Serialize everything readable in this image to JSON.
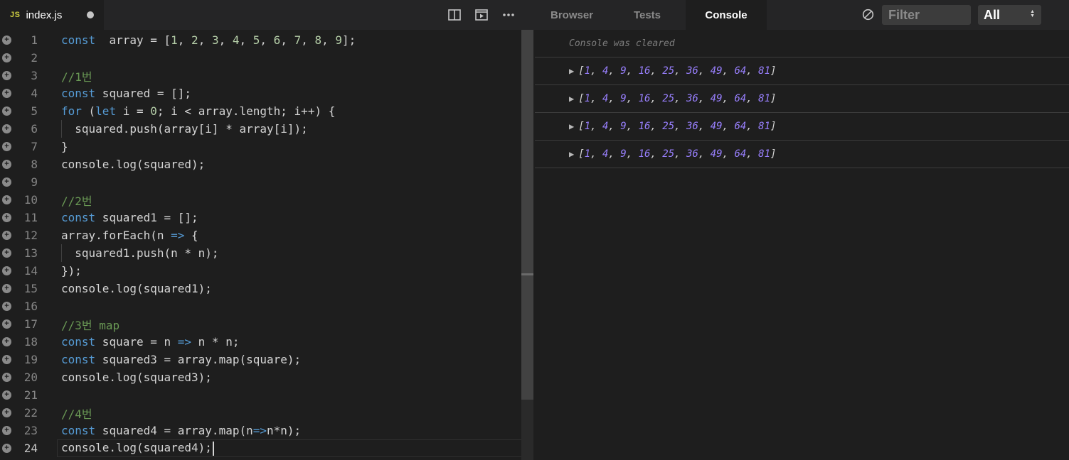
{
  "tab": {
    "icon": "JS",
    "name": "index.js"
  },
  "panel_tabs": [
    "Browser",
    "Tests",
    "Console"
  ],
  "filter": {
    "placeholder": "Filter",
    "level": "All"
  },
  "editor": {
    "lines": [
      {
        "num": "1",
        "tokens": [
          [
            "kw",
            "const"
          ],
          [
            "",
            "  array = ["
          ],
          [
            "nm",
            "1"
          ],
          [
            "",
            ", "
          ],
          [
            "nm",
            "2"
          ],
          [
            "",
            ", "
          ],
          [
            "nm",
            "3"
          ],
          [
            "",
            ", "
          ],
          [
            "nm",
            "4"
          ],
          [
            "",
            ", "
          ],
          [
            "nm",
            "5"
          ],
          [
            "",
            ", "
          ],
          [
            "nm",
            "6"
          ],
          [
            "",
            ", "
          ],
          [
            "nm",
            "7"
          ],
          [
            "",
            ", "
          ],
          [
            "nm",
            "8"
          ],
          [
            "",
            ", "
          ],
          [
            "nm",
            "9"
          ],
          [
            "",
            "];"
          ]
        ]
      },
      {
        "num": "2",
        "tokens": []
      },
      {
        "num": "3",
        "tokens": [
          [
            "cm",
            "//1번"
          ]
        ]
      },
      {
        "num": "4",
        "tokens": [
          [
            "kw",
            "const"
          ],
          [
            "",
            " squared = [];"
          ]
        ]
      },
      {
        "num": "5",
        "tokens": [
          [
            "kw",
            "for"
          ],
          [
            "",
            " ("
          ],
          [
            "kw",
            "let"
          ],
          [
            "",
            " i = "
          ],
          [
            "nm",
            "0"
          ],
          [
            "",
            "; i < array.length; i++) {"
          ]
        ]
      },
      {
        "num": "6",
        "tokens": [
          [
            "",
            "  squared.push(array[i] * array[i]);"
          ]
        ],
        "guide": true
      },
      {
        "num": "7",
        "tokens": [
          [
            "",
            "}"
          ]
        ]
      },
      {
        "num": "8",
        "tokens": [
          [
            "",
            "console.log(squared);"
          ]
        ]
      },
      {
        "num": "9",
        "tokens": []
      },
      {
        "num": "10",
        "tokens": [
          [
            "cm",
            "//2번"
          ]
        ]
      },
      {
        "num": "11",
        "tokens": [
          [
            "kw",
            "const"
          ],
          [
            "",
            " squared1 = [];"
          ]
        ]
      },
      {
        "num": "12",
        "tokens": [
          [
            "",
            "array.forEach(n "
          ],
          [
            "op",
            "=>"
          ],
          [
            "",
            " {"
          ]
        ]
      },
      {
        "num": "13",
        "tokens": [
          [
            "",
            "  squared1.push(n * n);"
          ]
        ],
        "guide": true
      },
      {
        "num": "14",
        "tokens": [
          [
            "",
            "});"
          ]
        ]
      },
      {
        "num": "15",
        "tokens": [
          [
            "",
            "console.log(squared1);"
          ]
        ]
      },
      {
        "num": "16",
        "tokens": []
      },
      {
        "num": "17",
        "tokens": [
          [
            "cm",
            "//3번 map"
          ]
        ]
      },
      {
        "num": "18",
        "tokens": [
          [
            "kw",
            "const"
          ],
          [
            "",
            " square = n "
          ],
          [
            "op",
            "=>"
          ],
          [
            "",
            " n * n;"
          ]
        ]
      },
      {
        "num": "19",
        "tokens": [
          [
            "kw",
            "const"
          ],
          [
            "",
            " squared3 = array.map(square);"
          ]
        ]
      },
      {
        "num": "20",
        "tokens": [
          [
            "",
            "console.log(squared3);"
          ]
        ]
      },
      {
        "num": "21",
        "tokens": []
      },
      {
        "num": "22",
        "tokens": [
          [
            "cm",
            "//4번"
          ]
        ]
      },
      {
        "num": "23",
        "tokens": [
          [
            "kw",
            "const"
          ],
          [
            "",
            " squared4 = array.map(n"
          ],
          [
            "op",
            "=>"
          ],
          [
            "",
            "n*n);"
          ]
        ]
      },
      {
        "num": "24",
        "tokens": [
          [
            "",
            "console.log(squared4);"
          ]
        ],
        "current": true
      }
    ]
  },
  "console": {
    "cleared_message": "Console was cleared",
    "entries": [
      {
        "values": [
          "1",
          "4",
          "9",
          "16",
          "25",
          "36",
          "49",
          "64",
          "81"
        ]
      },
      {
        "values": [
          "1",
          "4",
          "9",
          "16",
          "25",
          "36",
          "49",
          "64",
          "81"
        ]
      },
      {
        "values": [
          "1",
          "4",
          "9",
          "16",
          "25",
          "36",
          "49",
          "64",
          "81"
        ]
      },
      {
        "values": [
          "1",
          "4",
          "9",
          "16",
          "25",
          "36",
          "49",
          "64",
          "81"
        ]
      }
    ]
  }
}
